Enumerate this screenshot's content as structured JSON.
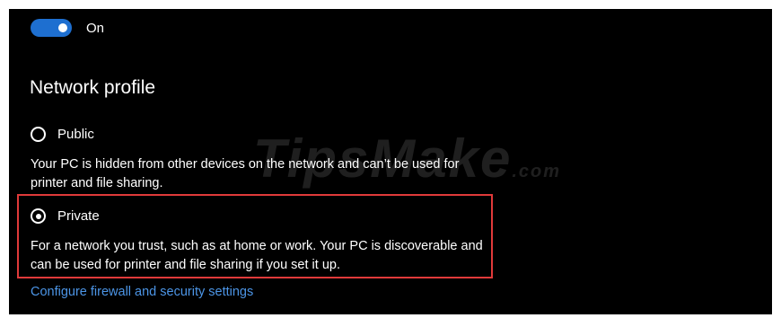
{
  "toggle": {
    "state_label": "On",
    "is_on": true,
    "accent": "#1e6fd0"
  },
  "network_profile": {
    "title": "Network profile",
    "options": [
      {
        "label": "Public",
        "selected": false,
        "description": "Your PC is hidden from other devices on the network and can’t be used for printer and file sharing."
      },
      {
        "label": "Private",
        "selected": true,
        "description": "For a network you trust, such as at home or work. Your PC is discoverable and can be used for printer and file sharing if you set it up."
      }
    ]
  },
  "link": {
    "label": "Configure firewall and security settings",
    "color": "#4c95e6"
  },
  "watermark": {
    "text": "TipsMake",
    "suffix": ".com"
  },
  "highlight_color": "#e03a3a"
}
